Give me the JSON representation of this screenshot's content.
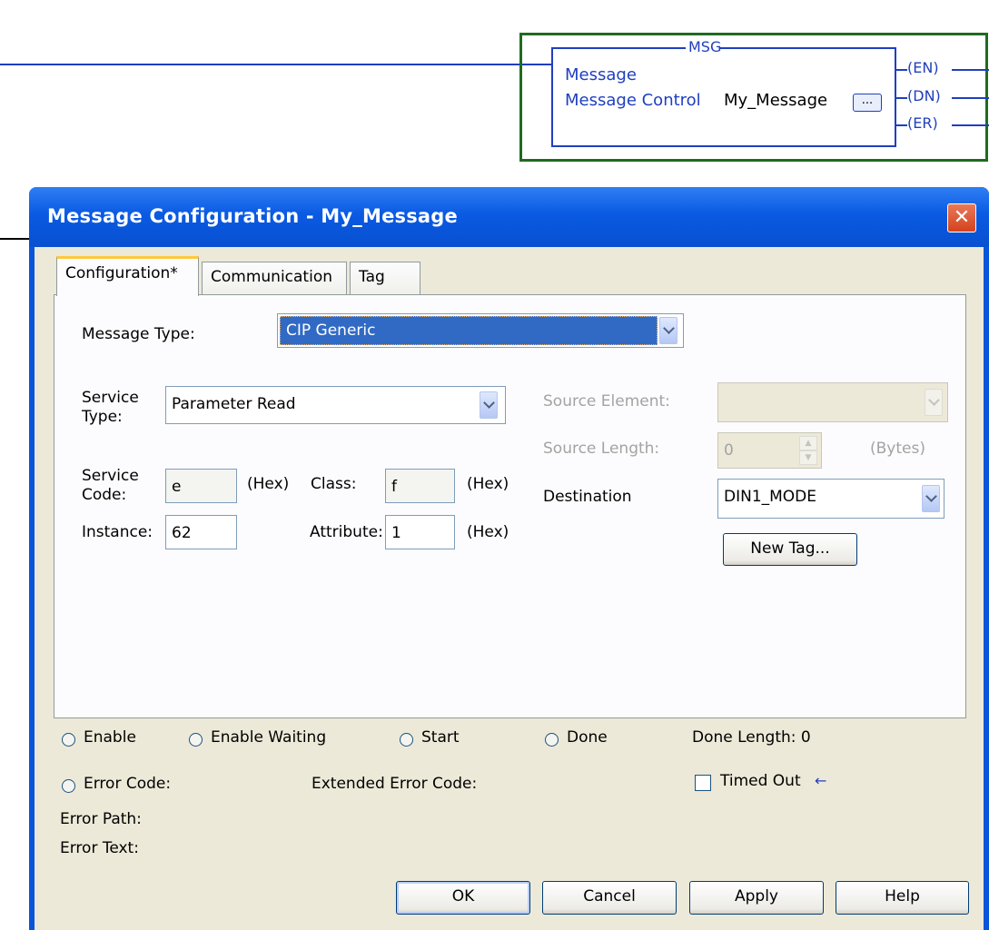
{
  "ladder": {
    "msg_title": "MSG",
    "line1": "Message",
    "line2_label": "Message Control",
    "line2_tag": "My_Message",
    "ellipsis": "...",
    "coils": [
      "EN",
      "DN",
      "ER"
    ]
  },
  "dialog": {
    "title": "Message Configuration - My_Message",
    "close": "✕",
    "tabs": [
      "Configuration*",
      "Communication",
      "Tag"
    ],
    "config": {
      "message_type_label": "Message Type:",
      "message_type_value": "CIP Generic",
      "service_type_label_1": "Service",
      "service_type_label_2": "Type:",
      "service_type_value": "Parameter Read",
      "service_code_label_1": "Service",
      "service_code_label_2": "Code:",
      "service_code_value": "e",
      "hex_1": "(Hex)",
      "class_label": "Class:",
      "class_value": "f",
      "hex_2": "(Hex)",
      "instance_label": "Instance:",
      "instance_value": "62",
      "attribute_label": "Attribute:",
      "attribute_value": "1",
      "hex_3": "(Hex)",
      "source_element_label": "Source Element:",
      "source_element_value": "",
      "source_length_label": "Source Length:",
      "source_length_value": "0",
      "bytes_label": "(Bytes)",
      "destination_label": "Destination",
      "destination_value": "DIN1_MODE",
      "new_tag_button": "New Tag..."
    },
    "status": {
      "enable": "Enable",
      "enable_waiting": "Enable Waiting",
      "start": "Start",
      "done": "Done",
      "done_length": "Done Length: 0",
      "error_code": "Error Code:",
      "extended_error_code": "Extended Error Code:",
      "timed_out": "Timed Out",
      "timed_out_arrow": "←",
      "error_path": "Error Path:",
      "error_text": "Error Text:"
    },
    "buttons": {
      "ok": "OK",
      "cancel": "Cancel",
      "apply": "Apply",
      "help": "Help"
    }
  }
}
